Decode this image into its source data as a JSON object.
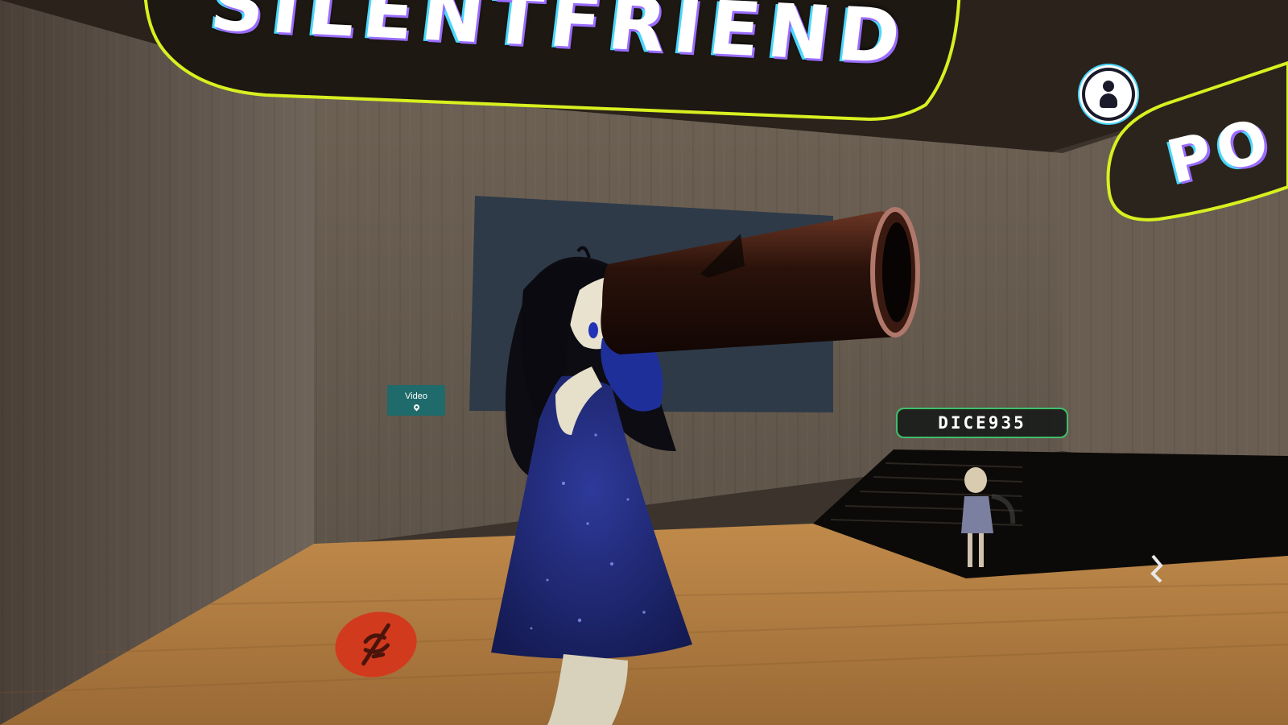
{
  "world": {
    "sign_main": "SILENTFRIEND",
    "sign_right_partial": "PO",
    "video_pin_label": "Video"
  },
  "players": {
    "remote_user_name": "DICE935"
  },
  "hud": {
    "info_icon": "info-person-icon",
    "mic_status_icon": "mic-muted-icon",
    "mic_status_color": "#d23a1e"
  },
  "colors": {
    "sign_outline": "#d8f020",
    "nameplate_outline": "#3fbf6a",
    "video_pin_bg": "#1f6a6a"
  }
}
